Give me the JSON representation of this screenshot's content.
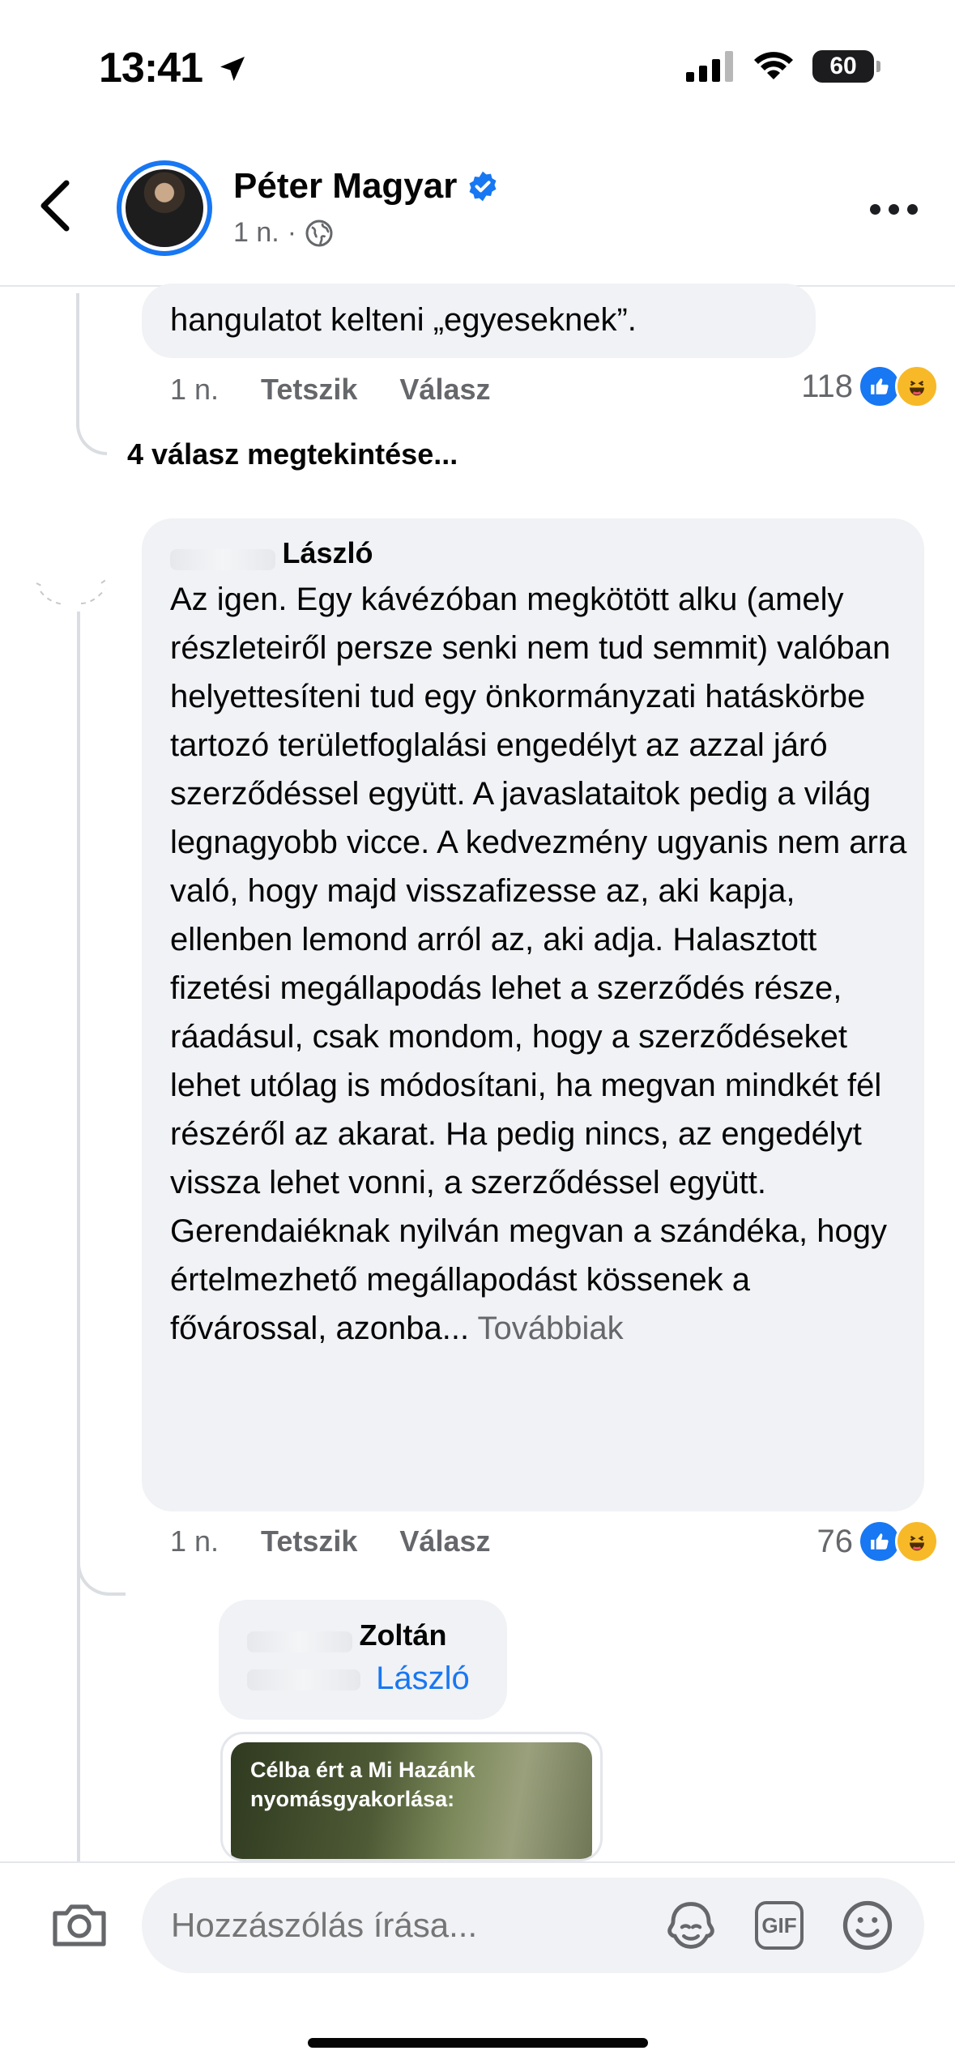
{
  "status_bar": {
    "time": "13:41",
    "battery": "60"
  },
  "header": {
    "name": "Péter Magyar",
    "time_ago": "1 n.",
    "separator": "·"
  },
  "comment1": {
    "text_visible": "hangulatot kelteni „egyeseknek”.",
    "time": "1 n.",
    "like_label": "Tetszik",
    "reply_label": "Válasz",
    "reaction_count": "118"
  },
  "view_replies": "4 válasz megtekintése...",
  "comment2": {
    "author": "László",
    "text": "Az igen. Egy kávézóban megkötött alku (amely részleteiről persze senki nem tud semmit) valóban helyettesíteni tud egy önkormányzati hatáskörbe tartozó területfoglalási engedélyt az azzal járó szerződéssel együtt. A javaslataitok pedig a világ legnagyobb vicce. A kedvezmény ugyanis nem arra való, hogy majd visszafizesse az, aki kapja, ellenben lemond arról az, aki adja. Halasztott fizetési megállapodás lehet a szerződés része, ráadásul, csak mondom, hogy a szerződéseket lehet utólag is módosítani, ha megvan mindkét fél részéről az akarat. Ha pedig nincs, az engedélyt vissza lehet vonni, a szerződéssel együtt. Gerendaiéknak nyilván megvan a szándéka, hogy értelmezhető megállapodást kössenek a fővárossal, azonba...",
    "more_label": "Továbbiak",
    "time": "1 n.",
    "like_label": "Tetszik",
    "reply_label": "Válasz",
    "reaction_count": "76"
  },
  "reply1": {
    "author": "Zoltán",
    "mention": "László",
    "image_caption": "Célba ért a Mi Hazánk nyomásgyakorlása:"
  },
  "composer": {
    "placeholder": "Hozzászólás írása...",
    "gif_label": "GIF"
  },
  "colors": {
    "accent": "#1877f2",
    "bubble": "#f0f2f5",
    "muted": "#65676b"
  }
}
